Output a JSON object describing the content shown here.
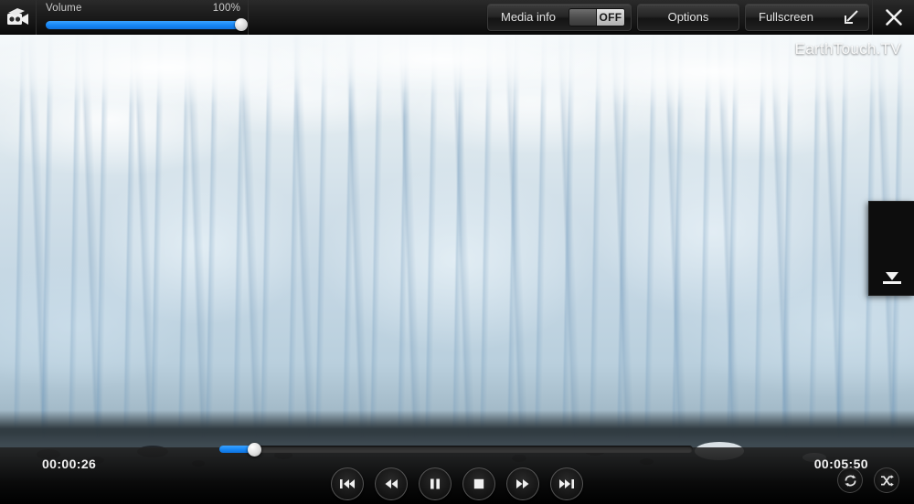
{
  "player": {
    "app_icon": "movie-camera-icon",
    "watermark": "EarthTouch.TV"
  },
  "topbar": {
    "volume": {
      "label": "Volume",
      "value_text": "100%",
      "value_pct": 100,
      "knob_pct": 100
    },
    "media_info": {
      "label": "Media info",
      "toggle_state": "OFF"
    },
    "options": {
      "label": "Options"
    },
    "fullscreen": {
      "label": "Fullscreen",
      "icon": "exit-fullscreen-icon"
    },
    "close": {
      "icon": "close-icon"
    }
  },
  "overlay": {
    "download": {
      "icon": "download-icon"
    }
  },
  "bottombar": {
    "current_time": "00:00:26",
    "total_time": "00:05:50",
    "progress_pct": 7.4,
    "transport": [
      {
        "name": "previous-track-button",
        "icon": "skip-previous-icon"
      },
      {
        "name": "rewind-button",
        "icon": "rewind-icon"
      },
      {
        "name": "pause-button",
        "icon": "pause-icon"
      },
      {
        "name": "stop-button",
        "icon": "stop-icon"
      },
      {
        "name": "fast-forward-button",
        "icon": "fast-forward-icon"
      },
      {
        "name": "next-track-button",
        "icon": "skip-next-icon"
      }
    ],
    "repeat": {
      "icon": "repeat-icon"
    },
    "shuffle": {
      "icon": "shuffle-icon"
    }
  },
  "colors": {
    "accent_blue": "#1787f5",
    "bar_dark": "#1d1d1d",
    "text_light": "#e2e2e2"
  }
}
